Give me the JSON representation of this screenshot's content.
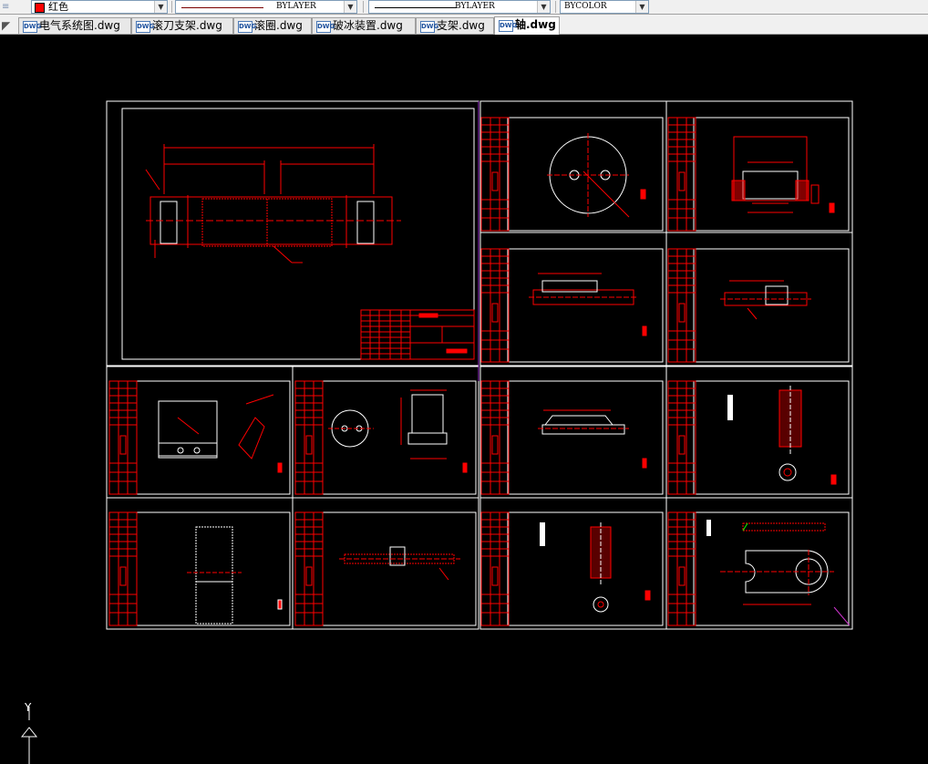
{
  "toolbar": {
    "color_label": "红色",
    "linetype_label": "BYLAYER",
    "lineweight_label": "BYLAYER",
    "plotstyle_label": "BYCOLOR"
  },
  "tabs": [
    {
      "label": "电气系统图.dwg",
      "active": false
    },
    {
      "label": "滚刀支架.dwg",
      "active": false
    },
    {
      "label": "滚圈.dwg",
      "active": false
    },
    {
      "label": "破冰装置.dwg",
      "active": false
    },
    {
      "label": "支架.dwg",
      "active": false
    },
    {
      "label": "轴.dwg",
      "active": true
    }
  ],
  "ucs": {
    "y_label": "Y"
  },
  "colors": {
    "sheet_border": "#ffffff",
    "drawing": "#ff0000",
    "background": "#000000"
  }
}
